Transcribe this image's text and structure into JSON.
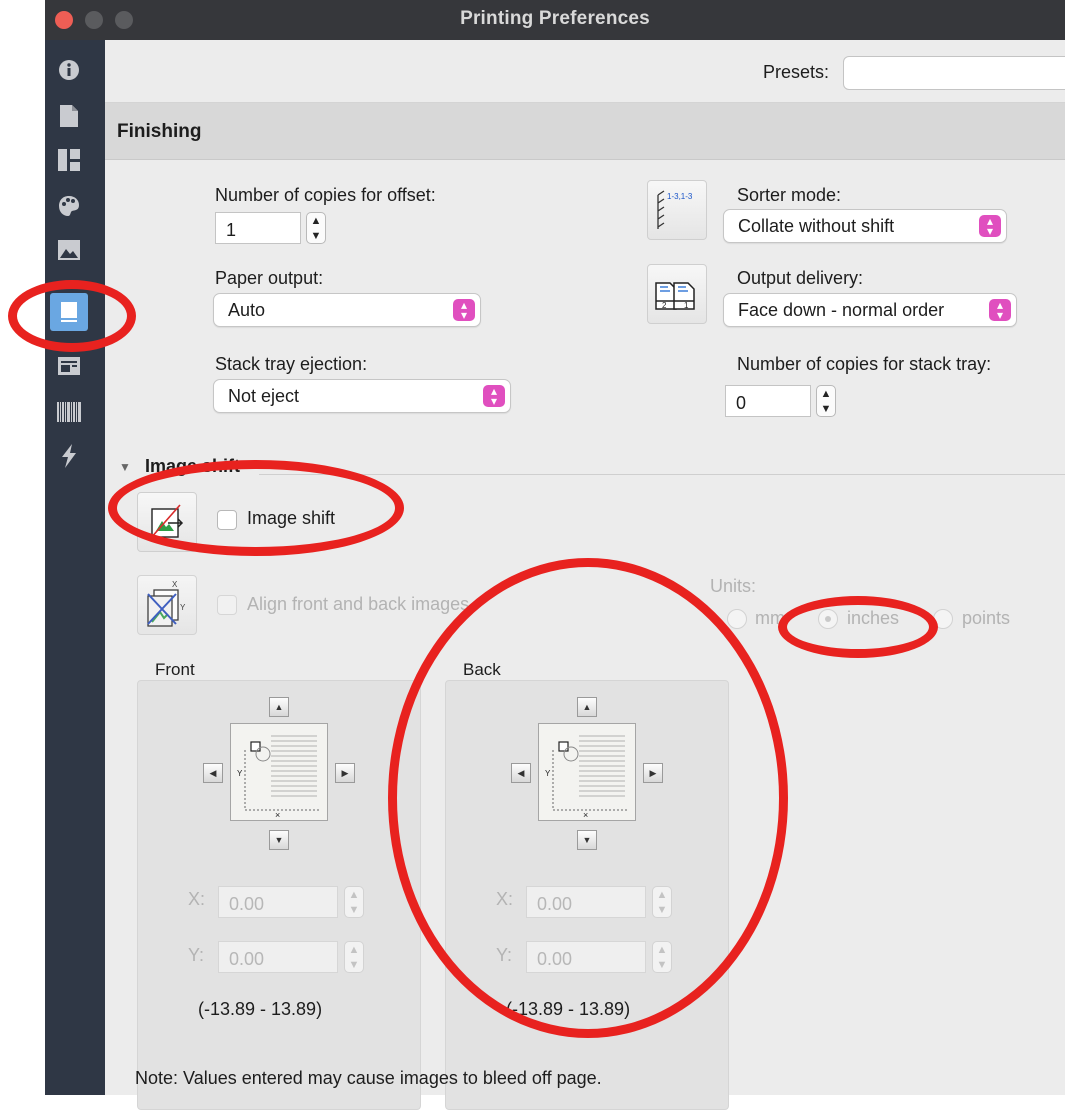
{
  "window": {
    "title": "Printing Preferences"
  },
  "sidebar": {
    "items": [
      {
        "icon": "info-icon"
      },
      {
        "icon": "document-icon"
      },
      {
        "icon": "layout-icon"
      },
      {
        "icon": "palette-icon"
      },
      {
        "icon": "image-icon"
      },
      {
        "icon": "finishing-book-icon",
        "active": true
      },
      {
        "icon": "media-tray-icon"
      },
      {
        "icon": "barcode-icon"
      },
      {
        "icon": "lightning-icon"
      }
    ]
  },
  "presets": {
    "label": "Presets:",
    "value": ""
  },
  "finishing": {
    "title": "Finishing",
    "copies_offset": {
      "label": "Number of copies for offset:",
      "value": "1"
    },
    "paper_output": {
      "label": "Paper output:",
      "value": "Auto"
    },
    "stack_tray_ejection": {
      "label": "Stack tray ejection:",
      "value": "Not eject"
    },
    "sorter_mode": {
      "label": "Sorter mode:",
      "value": "Collate without shift",
      "icon_text": "1-3,1-3"
    },
    "output_delivery": {
      "label": "Output delivery:",
      "value": "Face down - normal order"
    },
    "copies_stack_tray": {
      "label": "Number of copies for stack tray:",
      "value": "0"
    }
  },
  "image_shift": {
    "section_title": "Image shift",
    "checkbox_label": "Image shift",
    "align_label": "Align front and back images",
    "units": {
      "label": "Units:",
      "options": [
        "mm",
        "inches",
        "points"
      ],
      "selected": "inches"
    },
    "front": {
      "title": "Front",
      "x_label": "X:",
      "x_value": "0.00",
      "y_label": "Y:",
      "y_value": "0.00",
      "range": "(-13.89 - 13.89)"
    },
    "back": {
      "title": "Back",
      "x_label": "X:",
      "x_value": "0.00",
      "y_label": "Y:",
      "y_value": "0.00",
      "range": "(-13.89 - 13.89)"
    },
    "note": "Note: Values entered may cause images to bleed off page."
  },
  "colors": {
    "sidebar": "#2f3745",
    "sidebar_active": "#6aa7e2",
    "popup_accent": "#e04fbf",
    "annotation_red": "#e8221f"
  }
}
